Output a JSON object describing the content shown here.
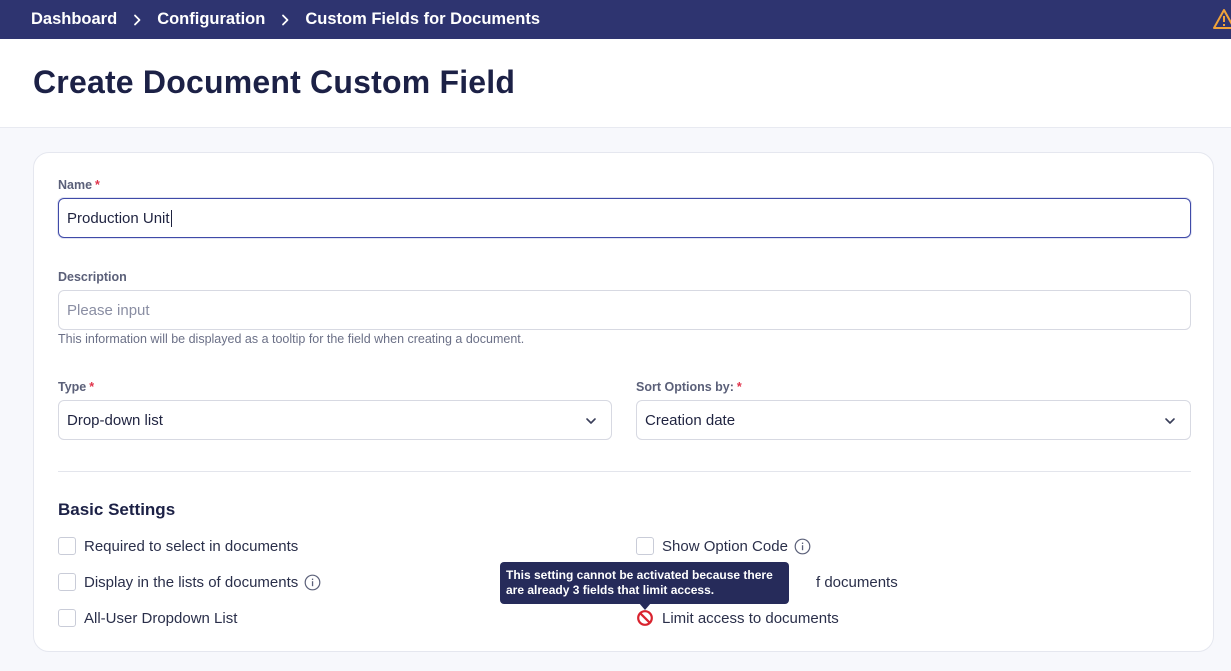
{
  "breadcrumb": {
    "items": [
      "Dashboard",
      "Configuration",
      "Custom Fields for Documents"
    ]
  },
  "header": {
    "title": "Create Document Custom Field"
  },
  "form": {
    "name": {
      "label": "Name",
      "required_mark": "*",
      "value": "Production Unit"
    },
    "description": {
      "label": "Description",
      "placeholder": "Please input",
      "hint": "This information will be displayed as a tooltip for the field when creating a document."
    },
    "type": {
      "label": "Type",
      "required_mark": "*",
      "value": "Drop-down list"
    },
    "sort": {
      "label": "Sort Options by:",
      "required_mark": "*",
      "value": "Creation date"
    }
  },
  "basic_settings": {
    "title": "Basic Settings",
    "left": [
      {
        "label": "Required to select in documents",
        "checked": false
      },
      {
        "label": "Display in the lists of documents",
        "checked": false,
        "info": true
      },
      {
        "label": "All-User Dropdown List",
        "checked": false
      }
    ],
    "right": [
      {
        "label": "Show Option Code",
        "checked": false,
        "info": true
      },
      {
        "label": "f documents",
        "checked": false
      },
      {
        "label": "Limit access to documents",
        "disabled": true
      }
    ]
  },
  "tooltip": {
    "line1": "This setting cannot be activated because there",
    "line2": "are already 3 fields that limit access."
  },
  "colors": {
    "topbar": "#2e3470",
    "title": "#1c2146",
    "required": "#e0344b",
    "disabled_icon": "#d9232e",
    "tooltip_bg": "#262b5a"
  },
  "icons": [
    "chevron-right-icon",
    "warning-icon",
    "chevron-down-icon",
    "info-icon",
    "ban-icon"
  ]
}
